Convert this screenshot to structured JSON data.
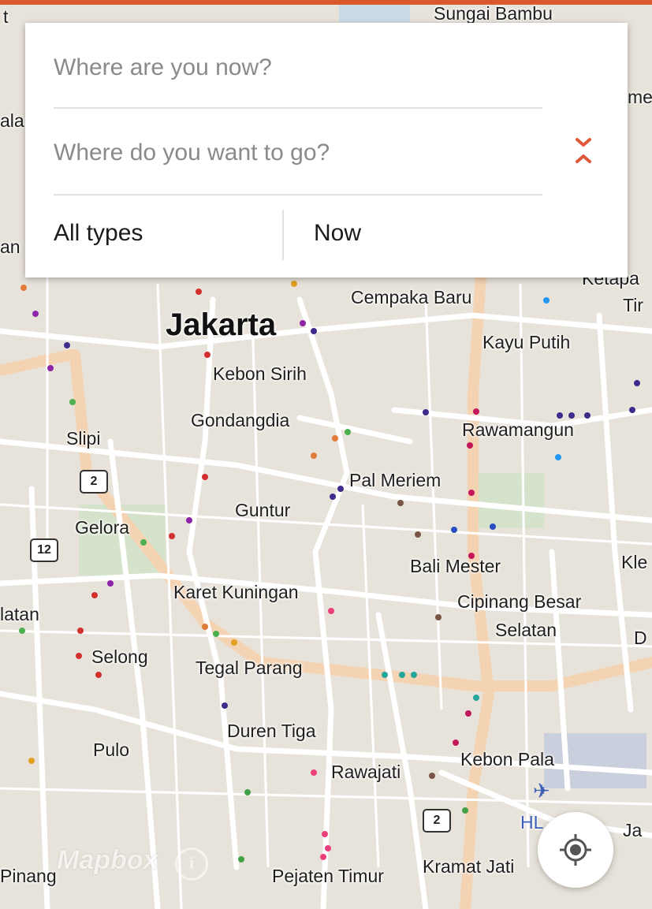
{
  "search": {
    "from_placeholder": "Where are you now?",
    "to_placeholder": "Where do you want to go?",
    "type_label": "All types",
    "time_label": "Now"
  },
  "map": {
    "attribution": "Mapbox",
    "info_label": "i",
    "places": {
      "sungai_bambu": "Sungai Bambu",
      "jakarta": "Jakarta",
      "cempaka_baru": "Cempaka Baru",
      "kayu_putih": "Kayu Putih",
      "kebon_sirih": "Kebon Sirih",
      "gondangdia": "Gondangdia",
      "slipi": "Slipi",
      "rawamangun": "Rawamangun",
      "pal_meriem": "Pal Meriem",
      "guntur": "Guntur",
      "gelora": "Gelora",
      "bali_mester": "Bali Mester",
      "karet_kuningan": "Karet Kuningan",
      "cipinang_besar": "Cipinang Besar",
      "selatan": "Selatan",
      "selong": "Selong",
      "tegal_parang": "Tegal Parang",
      "duren_tiga": "Duren Tiga",
      "pulo": "Pulo",
      "rawajati": "Rawajati",
      "kebon_pala": "Kebon Pala",
      "pejaten_timur": "Pejaten Timur",
      "kramat_jati": "Kramat Jati",
      "hl": "HL",
      "ja": "Ja",
      "pinang": "Pinang",
      "latan": "latan",
      "kle": "Kle",
      "d": "D",
      "ketapa": "Ketapa",
      "tir": "Tir",
      "me": "me",
      "ala": "ala",
      "an": "an",
      "t": "t"
    },
    "shields": {
      "s2a": "2",
      "s12": "12",
      "s2b": "2"
    }
  },
  "colors": {
    "accent": "#e0573a",
    "topbar": "#d9582c",
    "map_bg": "#e8e3da",
    "road": "#ffffff",
    "major_road": "#f4d3b3"
  },
  "icons": {
    "swap": "swap-vertical-icon",
    "locate": "my-location-icon",
    "airport": "airplane-icon",
    "info": "info-icon"
  }
}
